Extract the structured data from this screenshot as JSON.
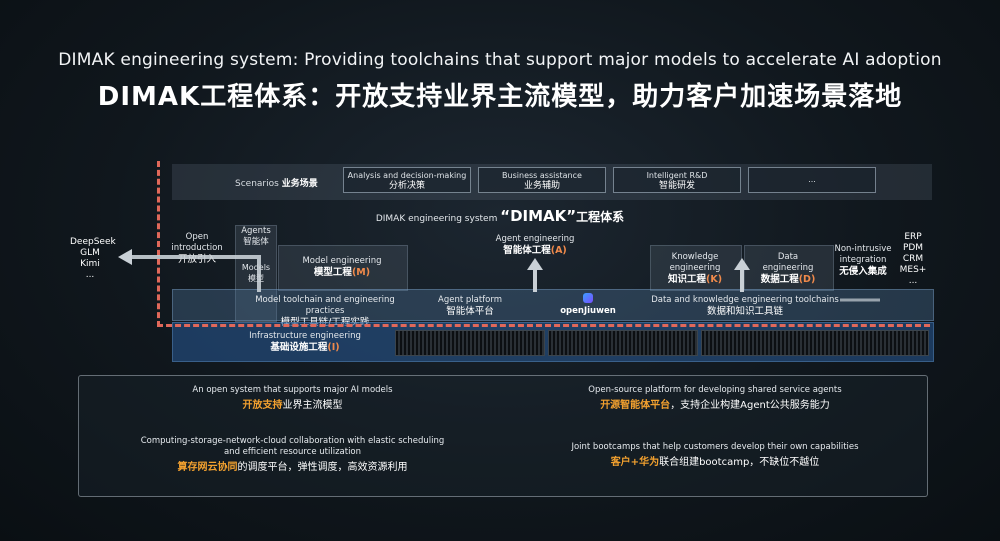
{
  "title": {
    "en": "DIMAK engineering system: Providing toolchains that support major models to accelerate AI adoption",
    "zh": "DIMAK工程体系：开放支持业界主流模型，助力客户加速场景落地"
  },
  "scenarios": {
    "label_en": "Scenarios",
    "label_zh": "业务场景",
    "items": [
      {
        "en": "Analysis and decision-making",
        "zh": "分析决策"
      },
      {
        "en": "Business assistance",
        "zh": "业务辅助"
      },
      {
        "en": "Intelligent R&D",
        "zh": "智能研发"
      },
      {
        "en": "...",
        "zh": ""
      }
    ]
  },
  "system": {
    "en": "DIMAK engineering system",
    "name": "“DIMAK”",
    "zh": "工程体系"
  },
  "open_intro": {
    "en": "Open introduction",
    "zh": "开放引入"
  },
  "agents": {
    "en": "Agents",
    "zh": "智能体"
  },
  "models": {
    "en": "Models",
    "zh": "模型"
  },
  "model_engineering": {
    "en": "Model engineering",
    "zh": "模型工程",
    "code": "(M)"
  },
  "agent_engineering": {
    "en": "Agent engineering",
    "zh": "智能体工程",
    "code": "(A)"
  },
  "knowledge_engineering": {
    "en": "Knowledge engineering",
    "zh": "知识工程",
    "code": "(K)"
  },
  "data_engineering": {
    "en": "Data engineering",
    "zh": "数据工程",
    "code": "(D)"
  },
  "non_intrusive": {
    "en": "Non-intrusive integration",
    "zh": "无侵入集成"
  },
  "toolchain": {
    "model_en": "Model toolchain and engineering practices",
    "model_zh": "模型工具链/工程实践",
    "agent_en": "Agent platform",
    "agent_zh": "智能体平台",
    "openjiuwen": "openJiuwen",
    "data_en": "Data and knowledge engineering toolchains",
    "data_zh": "数据和知识工具链"
  },
  "infrastructure": {
    "en": "Infrastructure engineering",
    "zh": "基础设施工程",
    "code": "(I)"
  },
  "left_models": [
    "DeepSeek",
    "GLM",
    "Kimi",
    "..."
  ],
  "right_systems": [
    "ERP",
    "PDM",
    "CRM",
    "MES+",
    "..."
  ],
  "bottom": {
    "q1": {
      "en": "An open system that supports major AI models",
      "zh_hl": "开放支持",
      "zh_rest": "业界主流模型"
    },
    "q2": {
      "en": "Open-source platform for developing shared service agents",
      "zh_hl": "开源智能体平台",
      "zh_rest": "，支持企业构建Agent公共服务能力"
    },
    "q3": {
      "en1": "Computing-storage-network-cloud collaboration with elastic scheduling",
      "en2": "and efficient resource utilization",
      "zh_hl": "算存网云协同",
      "zh_rest": "的调度平台，弹性调度，高效资源利用"
    },
    "q4": {
      "en": "Joint bootcamps that help customers develop their own capabilities",
      "zh_hl": "客户+华为",
      "zh_rest": "联合组建bootcamp，不缺位不越位"
    }
  },
  "colors": {
    "accent_orange": "#f08a4b",
    "frame_red": "#e0685a",
    "highlight_yellow": "#f3a12f"
  }
}
